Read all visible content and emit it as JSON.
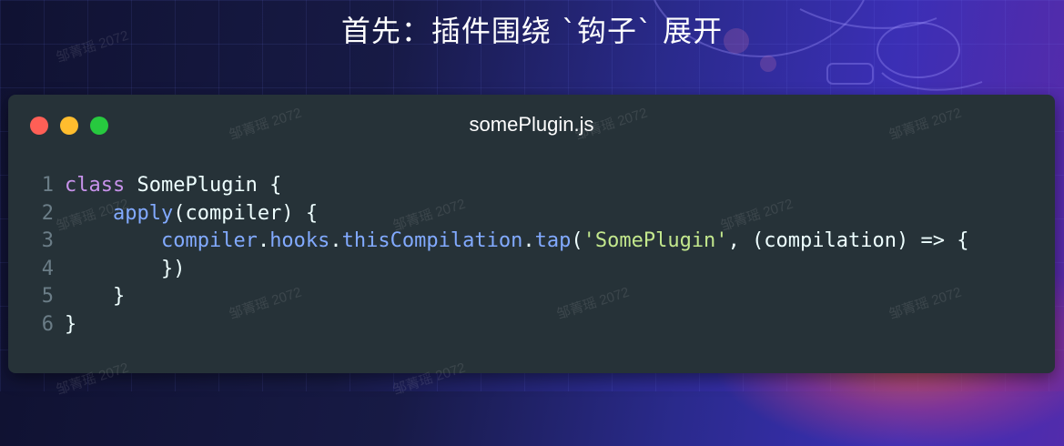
{
  "slide": {
    "title": "首先：插件围绕 `钩子` 展开",
    "watermark": "邹菁瑶 2072"
  },
  "window": {
    "filename": "somePlugin.js",
    "controls": {
      "close_color": "#ff5f56",
      "minimize_color": "#ffbd2e",
      "maximize_color": "#27c93f"
    }
  },
  "code": {
    "language": "javascript",
    "lines": [
      {
        "number": "1",
        "tokens": [
          {
            "text": "class",
            "kind": "keyword"
          },
          {
            "text": " SomePlugin {",
            "kind": "plain"
          }
        ]
      },
      {
        "number": "2",
        "tokens": [
          {
            "text": "    ",
            "kind": "plain"
          },
          {
            "text": "apply",
            "kind": "function"
          },
          {
            "text": "(compiler) {",
            "kind": "plain"
          }
        ]
      },
      {
        "number": "3",
        "tokens": [
          {
            "text": "        ",
            "kind": "plain"
          },
          {
            "text": "compiler",
            "kind": "prop"
          },
          {
            "text": ".",
            "kind": "plain"
          },
          {
            "text": "hooks",
            "kind": "prop"
          },
          {
            "text": ".",
            "kind": "plain"
          },
          {
            "text": "thisCompilation",
            "kind": "prop"
          },
          {
            "text": ".",
            "kind": "plain"
          },
          {
            "text": "tap",
            "kind": "prop"
          },
          {
            "text": "(",
            "kind": "plain"
          },
          {
            "text": "'SomePlugin'",
            "kind": "string"
          },
          {
            "text": ", (compilation) => {",
            "kind": "plain"
          }
        ]
      },
      {
        "number": "4",
        "tokens": [
          {
            "text": "        })",
            "kind": "plain"
          }
        ]
      },
      {
        "number": "5",
        "tokens": [
          {
            "text": "    }",
            "kind": "plain"
          }
        ]
      },
      {
        "number": "6",
        "tokens": [
          {
            "text": "}",
            "kind": "plain"
          }
        ]
      }
    ]
  },
  "theme": {
    "background_top": "#101232",
    "background_accent": "#3b2fb5",
    "editor_background": "#263238",
    "keyword_color": "#c792ea",
    "function_color": "#82aaff",
    "string_color": "#c3e88d",
    "text_color": "#eeffff",
    "line_number_color": "#6b7d87"
  }
}
